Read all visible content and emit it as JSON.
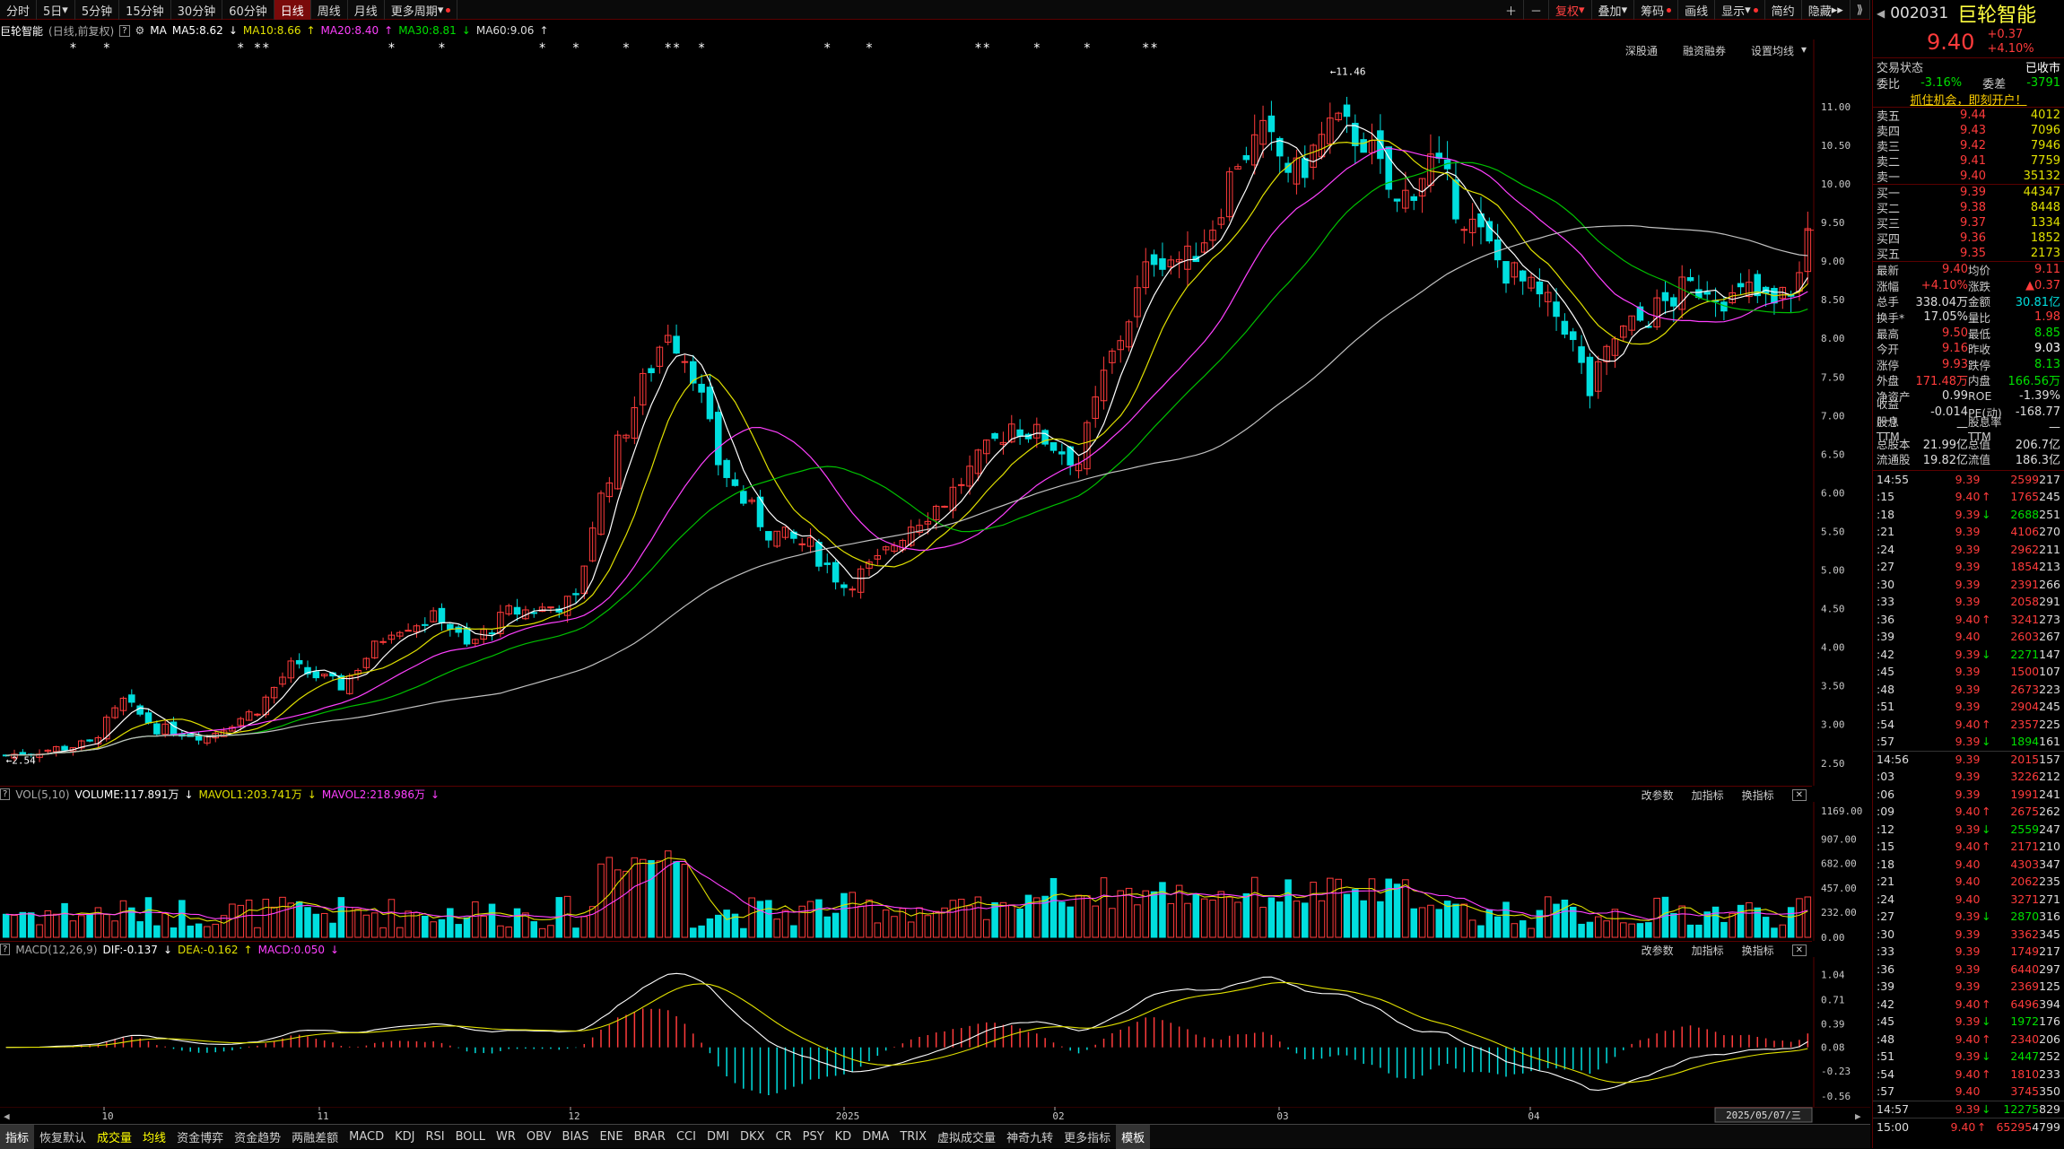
{
  "topbar": {
    "periods": [
      "分时",
      "5日",
      "5分钟",
      "15分钟",
      "30分钟",
      "60分钟",
      "日线",
      "周线",
      "月线",
      "更多周期"
    ],
    "active": "日线",
    "right_tools": [
      "复权",
      "叠加",
      "筹码",
      "画线",
      "显示",
      "简约",
      "隐藏"
    ]
  },
  "legend": {
    "name": "巨轮智能",
    "mode": "(日线,前复权)",
    "ma_label": "MA",
    "ma5": "MA5:8.62",
    "ma10": "MA10:8.66",
    "ma20": "MA20:8.40",
    "ma30": "MA30:8.81",
    "ma60": "MA60:9.06",
    "links": [
      "深股通",
      "融资融券",
      "设置均线"
    ]
  },
  "main_axis": {
    "labels": [
      "11.00",
      "10.50",
      "10.00",
      "9.50",
      "9.00",
      "8.50",
      "8.00",
      "7.50",
      "7.00",
      "6.50",
      "6.00",
      "5.50",
      "5.00",
      "4.50",
      "4.00",
      "3.50",
      "3.00",
      "2.50"
    ],
    "high_marker": "11.46",
    "low_marker": "2.54"
  },
  "vol_panel": {
    "title": "VOL(5,10)",
    "volume": "VOLUME:117.891万",
    "mavol1": "MAVOL1:203.741万",
    "mavol2": "MAVOL2:218.986万",
    "links": [
      "改参数",
      "加指标",
      "换指标"
    ],
    "axis": [
      "1169.00",
      "907.00",
      "682.00",
      "457.00",
      "232.00",
      "0.00"
    ]
  },
  "macd_panel": {
    "title": "MACD(12,26,9)",
    "dif": "DIF:-0.137",
    "dea": "DEA:-0.162",
    "macd": "MACD:0.050",
    "links": [
      "改参数",
      "加指标",
      "换指标"
    ],
    "axis": [
      "1.04",
      "0.71",
      "0.39",
      "0.08",
      "-0.23",
      "-0.56"
    ]
  },
  "x_axis": {
    "labels": [
      "10",
      "11",
      "12",
      "2025",
      "02",
      "03",
      "04"
    ],
    "date_box": "2025/05/07/三"
  },
  "bottom_tabs": [
    "指标",
    "恢复默认",
    "成交量",
    "均线",
    "资金博弈",
    "资金趋势",
    "两融差额",
    "MACD",
    "KDJ",
    "RSI",
    "BOLL",
    "WR",
    "OBV",
    "BIAS",
    "ENE",
    "BRAR",
    "CCI",
    "DMI",
    "DKX",
    "CR",
    "PSY",
    "KD",
    "DMA",
    "TRIX",
    "虚拟成交量",
    "神奇九转",
    "更多指标",
    "模板"
  ],
  "quote": {
    "code": "002031",
    "name": "巨轮智能",
    "price": "9.40",
    "change": "+0.37",
    "pct": "+4.10%",
    "status_label": "交易状态",
    "status": "已收市",
    "weibi_label": "委比",
    "weibi": "-3.16%",
    "weicha_label": "委差",
    "weicha": "-3791",
    "promo": "抓住机会，即刻开户！",
    "sells": [
      {
        "label": "卖五",
        "price": "9.44",
        "vol": "4012"
      },
      {
        "label": "卖四",
        "price": "9.43",
        "vol": "7096"
      },
      {
        "label": "卖三",
        "price": "9.42",
        "vol": "7946"
      },
      {
        "label": "卖二",
        "price": "9.41",
        "vol": "7759"
      },
      {
        "label": "卖一",
        "price": "9.40",
        "vol": "35132"
      }
    ],
    "buys": [
      {
        "label": "买一",
        "price": "9.39",
        "vol": "44347"
      },
      {
        "label": "买二",
        "price": "9.38",
        "vol": "8448"
      },
      {
        "label": "买三",
        "price": "9.37",
        "vol": "1334"
      },
      {
        "label": "买四",
        "price": "9.36",
        "vol": "1852"
      },
      {
        "label": "买五",
        "price": "9.35",
        "vol": "2173"
      }
    ],
    "stats": [
      [
        "最新",
        "9.40",
        "均价",
        "9.11"
      ],
      [
        "涨幅",
        "+4.10%",
        "涨跌",
        "▲0.37"
      ],
      [
        "总手",
        "338.04万",
        "金额",
        "30.81亿"
      ],
      [
        "换手*",
        "17.05%",
        "量比",
        "1.98"
      ],
      [
        "最高",
        "9.50",
        "最低",
        "8.85"
      ],
      [
        "今开",
        "9.16",
        "昨收",
        "9.03"
      ],
      [
        "涨停",
        "9.93",
        "跌停",
        "8.13"
      ],
      [
        "外盘",
        "171.48万",
        "内盘",
        "166.56万"
      ],
      [
        "净资产",
        "0.99",
        "ROE",
        "-1.39%"
      ],
      [
        "收益(一)",
        "-0.014",
        "PE(动)",
        "-168.77"
      ],
      [
        "股息TTM",
        "—",
        "股息率TTM",
        "—"
      ],
      [
        "总股本",
        "21.99亿",
        "总值",
        "206.7亿"
      ],
      [
        "流通股",
        "19.82亿",
        "流值",
        "186.3亿"
      ]
    ],
    "ticks": [
      [
        "14:55",
        "9.39",
        "",
        "2599",
        "217"
      ],
      [
        ":15",
        "9.40",
        "up",
        "1765",
        "245"
      ],
      [
        ":18",
        "9.39",
        "down",
        "2688",
        "251"
      ],
      [
        ":21",
        "9.39",
        "",
        "4106",
        "270"
      ],
      [
        ":24",
        "9.39",
        "",
        "2962",
        "211"
      ],
      [
        ":27",
        "9.39",
        "",
        "1854",
        "213"
      ],
      [
        ":30",
        "9.39",
        "",
        "2391",
        "266"
      ],
      [
        ":33",
        "9.39",
        "",
        "2058",
        "291"
      ],
      [
        ":36",
        "9.40",
        "up",
        "3241",
        "273"
      ],
      [
        ":39",
        "9.40",
        "",
        "2603",
        "267"
      ],
      [
        ":42",
        "9.39",
        "down",
        "2271",
        "147"
      ],
      [
        ":45",
        "9.39",
        "",
        "1500",
        "107"
      ],
      [
        ":48",
        "9.39",
        "",
        "2673",
        "223"
      ],
      [
        ":51",
        "9.39",
        "",
        "2904",
        "245"
      ],
      [
        ":54",
        "9.40",
        "up",
        "2357",
        "225"
      ],
      [
        ":57",
        "9.39",
        "down",
        "1894",
        "161"
      ],
      [
        "14:56",
        "9.39",
        "",
        "2015",
        "157"
      ],
      [
        ":03",
        "9.39",
        "",
        "3226",
        "212"
      ],
      [
        ":06",
        "9.39",
        "",
        "1991",
        "241"
      ],
      [
        ":09",
        "9.40",
        "up",
        "2675",
        "262"
      ],
      [
        ":12",
        "9.39",
        "down",
        "2559",
        "247"
      ],
      [
        ":15",
        "9.40",
        "up",
        "2171",
        "210"
      ],
      [
        ":18",
        "9.40",
        "",
        "4303",
        "347"
      ],
      [
        ":21",
        "9.40",
        "",
        "2062",
        "235"
      ],
      [
        ":24",
        "9.40",
        "",
        "3271",
        "271"
      ],
      [
        ":27",
        "9.39",
        "down",
        "2870",
        "316"
      ],
      [
        ":30",
        "9.39",
        "",
        "3362",
        "345"
      ],
      [
        ":33",
        "9.39",
        "",
        "1749",
        "217"
      ],
      [
        ":36",
        "9.39",
        "",
        "6440",
        "297"
      ],
      [
        ":39",
        "9.39",
        "",
        "2369",
        "125"
      ],
      [
        ":42",
        "9.40",
        "up",
        "6496",
        "394"
      ],
      [
        ":45",
        "9.39",
        "down",
        "1972",
        "176"
      ],
      [
        ":48",
        "9.40",
        "up",
        "2340",
        "206"
      ],
      [
        ":51",
        "9.39",
        "down",
        "2447",
        "252"
      ],
      [
        ":54",
        "9.40",
        "up",
        "1810",
        "233"
      ],
      [
        ":57",
        "9.40",
        "",
        "3745",
        "350"
      ],
      [
        "14:57",
        "9.39",
        "down",
        "12275",
        "829"
      ],
      [
        "15:00",
        "9.40",
        "up",
        "65295",
        "4799"
      ]
    ]
  },
  "colors": {
    "up": "#ff3b3b",
    "down": "#00dede",
    "ma5": "#ffffff",
    "ma10": "#e0e000",
    "ma20": "#ff40ff",
    "ma30": "#00c000",
    "ma60": "#c0c0c0"
  }
}
